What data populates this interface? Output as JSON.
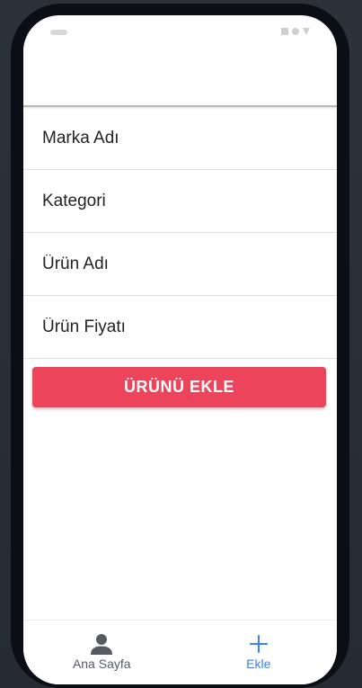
{
  "form": {
    "fields": [
      {
        "placeholder": "Marka Adı",
        "value": ""
      },
      {
        "placeholder": "Kategori",
        "value": ""
      },
      {
        "placeholder": "Ürün Adı",
        "value": ""
      },
      {
        "placeholder": "Ürün Fiyatı",
        "value": ""
      }
    ],
    "submit_label": "ÜRÜNÜ EKLE"
  },
  "tabs": [
    {
      "label": "Ana Sayfa",
      "icon": "person-icon",
      "active": false
    },
    {
      "label": "Ekle",
      "icon": "add-icon",
      "active": true
    }
  ],
  "colors": {
    "accent": "#ec445a",
    "tab_active": "#3880ff",
    "tab_inactive": "#555b61"
  }
}
